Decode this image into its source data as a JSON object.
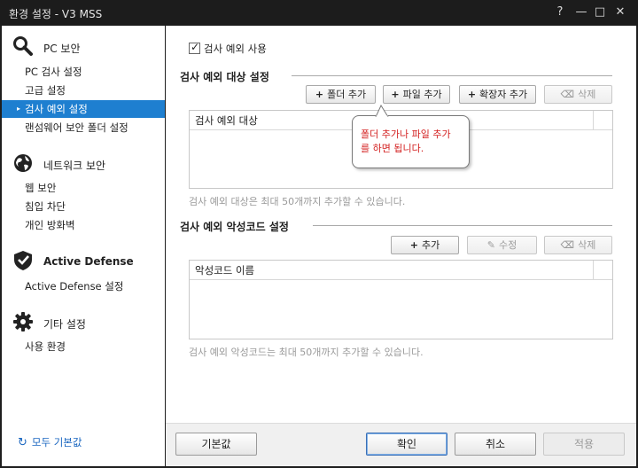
{
  "window": {
    "title": "환경 설정 - V3 MSS",
    "controls": {
      "help": "?",
      "minimize": "—",
      "maximize": "□",
      "close": "✕"
    }
  },
  "sidebar": {
    "sections": [
      {
        "label": "PC 보안",
        "icon": "search-icon",
        "items": [
          "PC 검사 설정",
          "고급 설정",
          "검사 예외 설정",
          "랜섬웨어 보안 폴더 설정"
        ]
      },
      {
        "label": "네트워크 보안",
        "icon": "globe-icon",
        "items": [
          "웹 보안",
          "침입 차단",
          "개인 방화벽"
        ]
      },
      {
        "label": "Active Defense",
        "icon": "shield-check-icon",
        "items": [
          "Active Defense 설정"
        ]
      },
      {
        "label": "기타 설정",
        "icon": "gear-icon",
        "items": [
          "사용 환경"
        ]
      }
    ],
    "active_item": "검사 예외 설정",
    "reset_all": "모두 기본값"
  },
  "main": {
    "enable_checkbox": {
      "label": "검사 예외 사용",
      "checked": true
    },
    "targets": {
      "title": "검사 예외 대상 설정",
      "buttons": {
        "add_folder": "폴더 추가",
        "add_file": "파일 추가",
        "add_extension": "확장자 추가",
        "delete": "삭제"
      },
      "column": "검사 예외 대상",
      "hint": "검사 예외 대상은 최대 50개까지 추가할 수 있습니다."
    },
    "tooltip": {
      "line1": "폴더 추가나 파일 추가",
      "line2": "를 하면 됩니다."
    },
    "malware": {
      "title": "검사 예외 악성코드 설정",
      "buttons": {
        "add": "추가",
        "edit": "수정",
        "delete": "삭제"
      },
      "column": "악성코드 이름",
      "hint": "검사 예외 악성코드는 최대 50개까지 추가할 수 있습니다."
    }
  },
  "footer": {
    "defaults": "기본값",
    "ok": "확인",
    "cancel": "취소",
    "apply": "적용"
  },
  "colors": {
    "accent": "#1e7fd0",
    "tooltip_text": "#d32020",
    "titlebar": "#1c1c1c"
  }
}
